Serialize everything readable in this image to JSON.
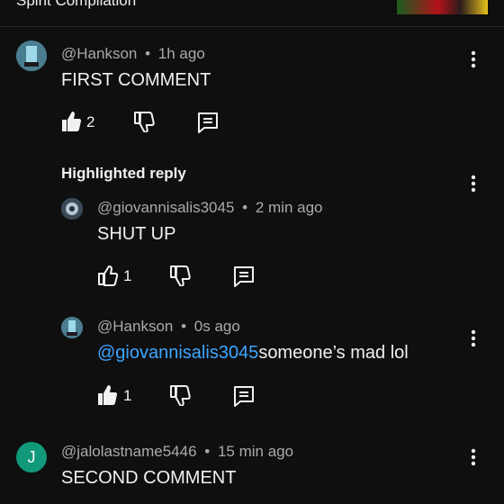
{
  "header": {
    "title": "Spirit Compilation"
  },
  "comments": [
    {
      "author": "@Hankson",
      "separator": "•",
      "time": "1h ago",
      "text": "FIRST COMMENT",
      "likes": "2"
    },
    {
      "highlighted_label": "Highlighted reply",
      "author": "@giovannisalis3045",
      "separator": "•",
      "time": "2 min ago",
      "text": "SHUT UP",
      "likes": "1"
    },
    {
      "author": "@Hankson",
      "separator": "•",
      "time": "0s ago",
      "mention": "@giovannisalis3045",
      "text": "someone’s mad lol",
      "likes": "1"
    },
    {
      "avatar_letter": "J",
      "author": "@jalolastname5446",
      "separator": "•",
      "time": "15 min ago",
      "text": "SECOND COMMENT"
    }
  ],
  "colors": {
    "background": "#0f0f0f",
    "mention": "#3ea6ff",
    "avatar_j": "#12987a"
  },
  "icons": [
    "like-icon",
    "dislike-icon",
    "reply-icon",
    "more-vertical-icon"
  ]
}
